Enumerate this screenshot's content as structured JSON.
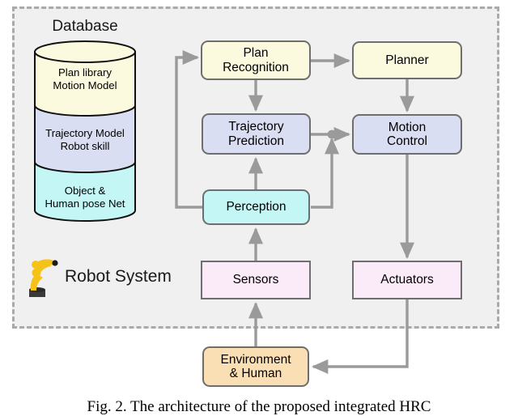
{
  "figure": {
    "caption": "Fig. 2.  The architecture of the proposed integrated HRC",
    "boundary_label": "robot-system-boundary"
  },
  "database": {
    "title": "Database",
    "segments": [
      {
        "name": "plan-library",
        "text": "Plan library\nMotion Model",
        "color": "#fbfade"
      },
      {
        "name": "trajectory-model",
        "text": "Trajectory Model\nRobot skill",
        "color": "#dadef2"
      },
      {
        "name": "object-human-pose",
        "text": "Object &\nHuman pose Net",
        "color": "#c5f6f6"
      }
    ]
  },
  "robot": {
    "label": "Robot System",
    "icon": "robot-arm-icon",
    "arm_color": "#f5c318",
    "base_color": "#3a3a3a"
  },
  "nodes": [
    {
      "id": "plan_recognition",
      "label": "Plan\nRecognition",
      "color": "#fbfade",
      "shape": "rounded"
    },
    {
      "id": "planner",
      "label": "Planner",
      "color": "#fbfade",
      "shape": "rounded"
    },
    {
      "id": "trajectory_prediction",
      "label": "Trajectory\nPrediction",
      "color": "#dadef2",
      "shape": "rounded"
    },
    {
      "id": "motion_control",
      "label": "Motion\nControl",
      "color": "#dadef2",
      "shape": "rounded"
    },
    {
      "id": "perception",
      "label": "Perception",
      "color": "#c5f6f6",
      "shape": "rounded"
    },
    {
      "id": "sensors",
      "label": "Sensors",
      "color": "#fbeaf8",
      "shape": "sharp"
    },
    {
      "id": "actuators",
      "label": "Actuators",
      "color": "#fbeaf8",
      "shape": "sharp"
    },
    {
      "id": "environment",
      "label": "Environment\n& Human",
      "color": "#fbdfb4",
      "shape": "rounded"
    }
  ],
  "edges": [
    {
      "from": "plan_recognition",
      "to": "planner"
    },
    {
      "from": "plan_recognition",
      "to": "trajectory_prediction"
    },
    {
      "from": "planner",
      "to": "motion_control"
    },
    {
      "from": "trajectory_prediction",
      "to": "motion_control"
    },
    {
      "from": "perception",
      "to": "trajectory_prediction"
    },
    {
      "from": "perception",
      "to": "motion_control"
    },
    {
      "from": "perception",
      "to": "plan_recognition"
    },
    {
      "from": "sensors",
      "to": "perception"
    },
    {
      "from": "motion_control",
      "to": "actuators"
    },
    {
      "from": "actuators",
      "to": "environment"
    },
    {
      "from": "environment",
      "to": "sensors"
    }
  ],
  "style": {
    "arrow_color": "#9a9a9a",
    "node_border": "#6e6e6e",
    "boundary_fill": "#f0f0f0",
    "boundary_stroke": "#aaaaaa",
    "page_bg": "#ffffff"
  }
}
